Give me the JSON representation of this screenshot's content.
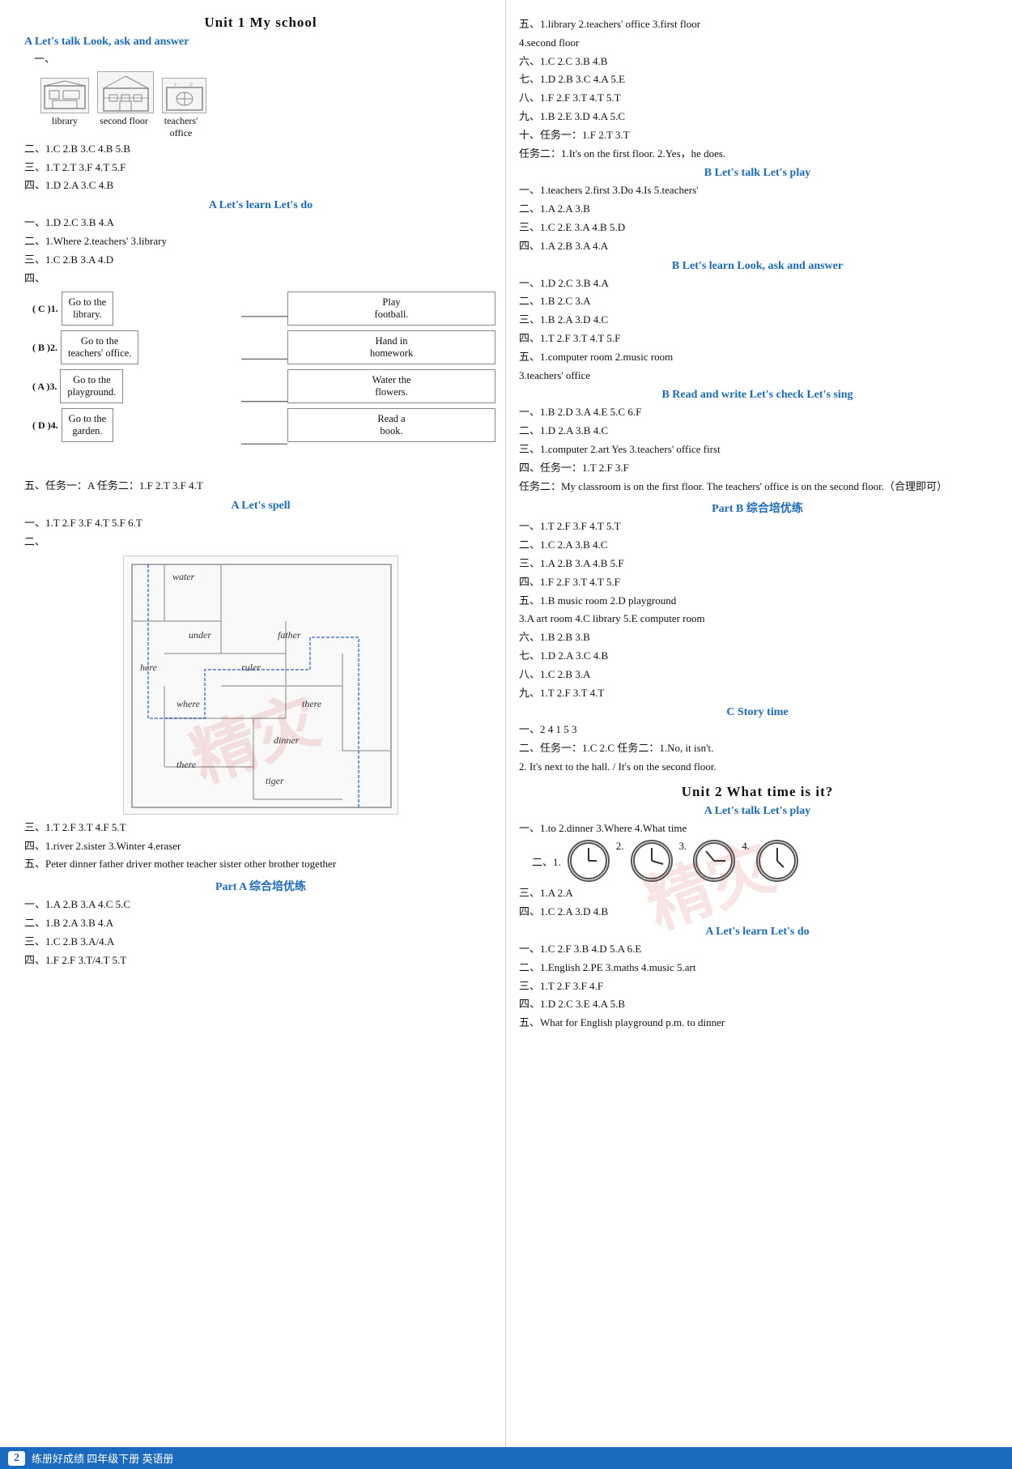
{
  "page": {
    "unit1_title": "Unit 1   My school",
    "unit2_title": "Unit 2   What time is it?",
    "left": {
      "sectionA_title": "A  Let's talk  Look, ask and answer",
      "img_labels": [
        "library",
        "second floor",
        "teachers' office"
      ],
      "lines_2": "二、1.C  2.B  3.C  4.B  5.B",
      "lines_3": "三、1.T  2.T  3.F  4.T  5.F",
      "lines_4": "四、1.D  2.A  3.C  4.B",
      "sectionA_learn": "A  Let's learn  Let's do",
      "learn1": "一、1.D  2.C  3.B  4.A",
      "learn2": "二、1.Where  2.teachers'  3.library",
      "learn3": "三、1.C  2.B  3.A  4.D",
      "match_labels": [
        "( C )1.",
        "( B )2.",
        "( A )3.",
        "( D )4."
      ],
      "match_left": [
        "Go to the library.",
        "Go to the teachers' office.",
        "Go to the playground.",
        "Go to the garden."
      ],
      "match_right": [
        "Play football.",
        "Hand in homework",
        "Water the flowers.",
        "Read a book."
      ],
      "wu5": "五、任务一：A  任务二：1.F  2.T  3.F  4.T",
      "spell_title": "A  Let's spell",
      "spell1": "一、1.T  2.F  3.F  4.T  5.F  6.T",
      "maze_words": [
        "water",
        "under",
        "father",
        "here",
        "ruler",
        "where",
        "there",
        "dinner",
        "there",
        "tiger"
      ],
      "san3": "三、1.T  2.F  3.T  4.F  5.T",
      "si4": "四、1.river  2.sister  3.Winter  4.eraser",
      "wu_peter": "五、Peter  dinner  father  driver  mother  teacher  sister  other  brother  together",
      "partA_title": "Part A  综合培优练",
      "partA1": "一、1.A  2.B  3.A  4.C  5.C",
      "partA2": "二、1.B  2.A  3.B  4.A",
      "partA3": "三、1.C  2.B  3.A/4.A",
      "partA4": "四、1.F  2.F  3.T/4.T  5.T"
    },
    "right": {
      "wu5_right": "五、1.library  2.teachers' office  3.first floor",
      "wu5_2": "4.second floor",
      "liu6": "六、1.C  2.C  3.B  4.B",
      "qi7": "七、1.D  2.B  3.C  4.A  5.E",
      "ba8": "八、1.F  2.F  3.T  4.T  5.T",
      "jiu9": "九、1.B  2.E  3.D  4.A  5.C",
      "shi10": "十、任务一：1.F  2.T  3.T",
      "renwu2": "任务二：1.It's on the first floor.  2.Yes，he does.",
      "sectB_talk": "B  Let's talk  Let's play",
      "B_talk1": "一、1.teachers  2.first  3.Do  4.Is  5.teachers'",
      "B_talk2": "二、1.A  2.A  3.B",
      "B_talk3": "三、1.C  2.E  3.A  4.B  5.D",
      "B_talk4": "四、1.A  2.B  3.A  4.A",
      "sectB_learn": "B  Let's learn  Look, ask and answer",
      "B_learn1": "一、1.D  2.C  3.B  4.A",
      "B_learn2": "二、1.B  2.C  3.A",
      "B_learn3": "三、1.B  2.A  3.D  4.C",
      "B_learn4": "四、1.T  2.F  3.T  4.T  5.F",
      "B_learn5": "五、1.computer room  2.music room",
      "B_learn5b": "3.teachers' office",
      "B_rw": "B  Read and write  Let's check  Let's sing",
      "B_rw1": "一、1.B  2.D  3.A  4.E  5.C  6.F",
      "B_rw2": "二、1.D  2.A  3.B  4.C",
      "B_rw3": "三、1.computer  2.art  Yes  3.teachers' office  first",
      "B_rw4": "四、任务一：1.T  2.F  3.F",
      "B_rw5": "任务二：My classroom is on the first floor. The teachers' office is on the second floor.（合理即可）",
      "partB_title": "Part B  综合培优练",
      "pB1": "一、1.T  2.F  3.F  4.T  5.T",
      "pB2": "二、1.C  2.A  3.B  4.C",
      "pB3": "三、1.A  2.B  3.A  4.B  5.F",
      "pB4": "四、1.F  2.F  3.T  4.T  5.F",
      "pB5": "五、1.B  music room  2.D  playground",
      "pB5b": "3.A  art room  4.C  library  5.E  computer room",
      "pB6": "六、1.B  2.B  3.B",
      "pB7": "七、1.D  2.A  3.C  4.B",
      "pB8": "八、1.C  2.B  3.A",
      "pB9": "九、1.T  2.F  3.T  4.T",
      "story_title": "C  Story time",
      "story1": "一、2  4  1  5  3",
      "story2": "二、任务一：1.C  2.C  任务二：1.No, it isn't.",
      "story3": "2. It's next to the hall. / It's on the second floor.",
      "unit2_title_local": "Unit 2   What time is it?",
      "u2_Atalk": "A  Let's talk  Let's play",
      "u2_At1": "一、1.to  2.dinner  3.Where  4.What time",
      "u2_At2_label": "二、1.",
      "u2_At3": "三、1.A  2.A",
      "u2_At4": "四、1.C  2.A  3.D  4.B",
      "u2_Alearn": "A  Let's learn  Let's do",
      "u2_Al1": "一、1.C  2.F  3.B  4.D  5.A  6.E",
      "u2_Al2": "二、1.English  2.PE  3.maths  4.music  5.art",
      "u2_Al3": "三、1.T  2.F  3.F  4.F",
      "u2_Al4": "四、1.D  2.C  3.E  4.A  5.B",
      "u2_Al5": "五、What  for  English  playground  p.m.  to  dinner"
    },
    "bottom": {
      "num": "2",
      "text": "练册好成绩 四年级下册 英语册"
    }
  }
}
